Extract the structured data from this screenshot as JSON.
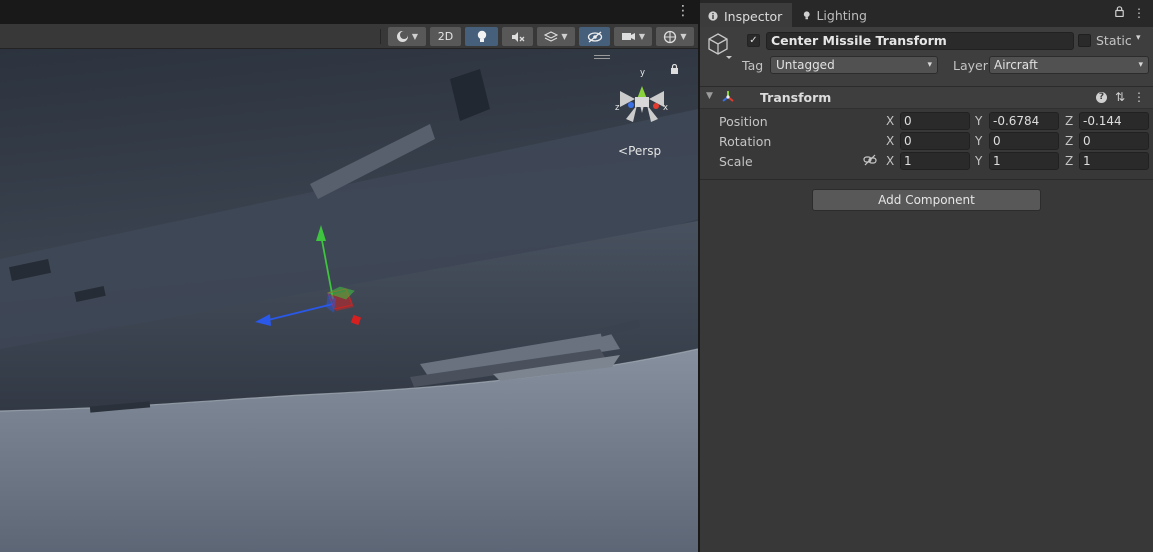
{
  "scene": {
    "menu_dots": "⋮",
    "toolbar": {
      "two_d_label": "2D",
      "colors": {
        "button": "#585858",
        "active": "#46607c",
        "bar": "#383838"
      }
    },
    "gizmo": {
      "persp_label": "Persp",
      "persp_arrow": "<",
      "axis_x": "x",
      "axis_y": "y",
      "axis_z": "z",
      "colors": {
        "x": "#e53b2e",
        "y": "#8ad33c",
        "z": "#3b6fe5"
      }
    },
    "move_handle": {
      "colors": {
        "x": "#d62020",
        "y": "#3ec43e",
        "z": "#2a58e8"
      }
    }
  },
  "inspector": {
    "tabs": [
      {
        "label": "Inspector",
        "icon": "info-icon"
      },
      {
        "label": "Lighting",
        "icon": "lightbulb-icon"
      }
    ],
    "tab_tools": {
      "lock": "lock-icon",
      "menu": "⋮"
    },
    "header": {
      "active_check": "✓",
      "name": "Center Missile Transform",
      "static_label": "Static",
      "static_caret": "▾",
      "tag_label": "Tag",
      "tag_value": "Untagged",
      "layer_label": "Layer",
      "layer_value": "Aircraft",
      "caret": "▾"
    },
    "transform": {
      "title": "Transform",
      "foldout": "▼",
      "tools": [
        "?",
        "⇅",
        "⋮"
      ],
      "rows": [
        {
          "label": "Position",
          "x": "0",
          "y": "-0.6784",
          "z": "-0.144"
        },
        {
          "label": "Rotation",
          "x": "0",
          "y": "0",
          "z": "0"
        },
        {
          "label": "Scale",
          "x": "1",
          "y": "1",
          "z": "1"
        }
      ],
      "axis_labels": {
        "x": "X",
        "y": "Y",
        "z": "Z"
      }
    },
    "add_component": "Add Component"
  }
}
